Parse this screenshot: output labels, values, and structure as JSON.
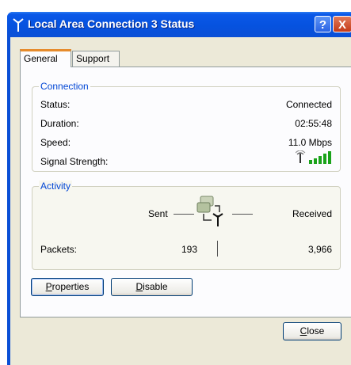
{
  "window": {
    "title": "Local Area Connection 3 Status",
    "help_glyph": "?",
    "close_glyph": "X"
  },
  "tabs": [
    {
      "label": "General",
      "selected": true
    },
    {
      "label": "Support",
      "selected": false
    }
  ],
  "connection": {
    "legend": "Connection",
    "rows": [
      {
        "label": "Status:",
        "value": "Connected"
      },
      {
        "label": "Duration:",
        "value": "02:55:48"
      },
      {
        "label": "Speed:",
        "value": "11.0 Mbps"
      },
      {
        "label": "Signal Strength:",
        "bars": 5
      }
    ]
  },
  "activity": {
    "legend": "Activity",
    "sent_label": "Sent",
    "received_label": "Received",
    "packets_label": "Packets:",
    "packets_sent": "193",
    "packets_received": "3,966"
  },
  "buttons": {
    "properties": {
      "prefix": "",
      "accel": "P",
      "rest": "roperties"
    },
    "disable": {
      "prefix": "",
      "accel": "D",
      "rest": "isable"
    },
    "close": {
      "prefix": "",
      "accel": "C",
      "rest": "lose"
    }
  },
  "colors": {
    "title_bar": "#0a4fd6",
    "group_header": "#0046d5",
    "signal": "#1aa31a"
  },
  "icons": {
    "title": "wireless-antenna-icon",
    "signal": "signal-strength-icon",
    "activity": "network-computers-icon"
  }
}
